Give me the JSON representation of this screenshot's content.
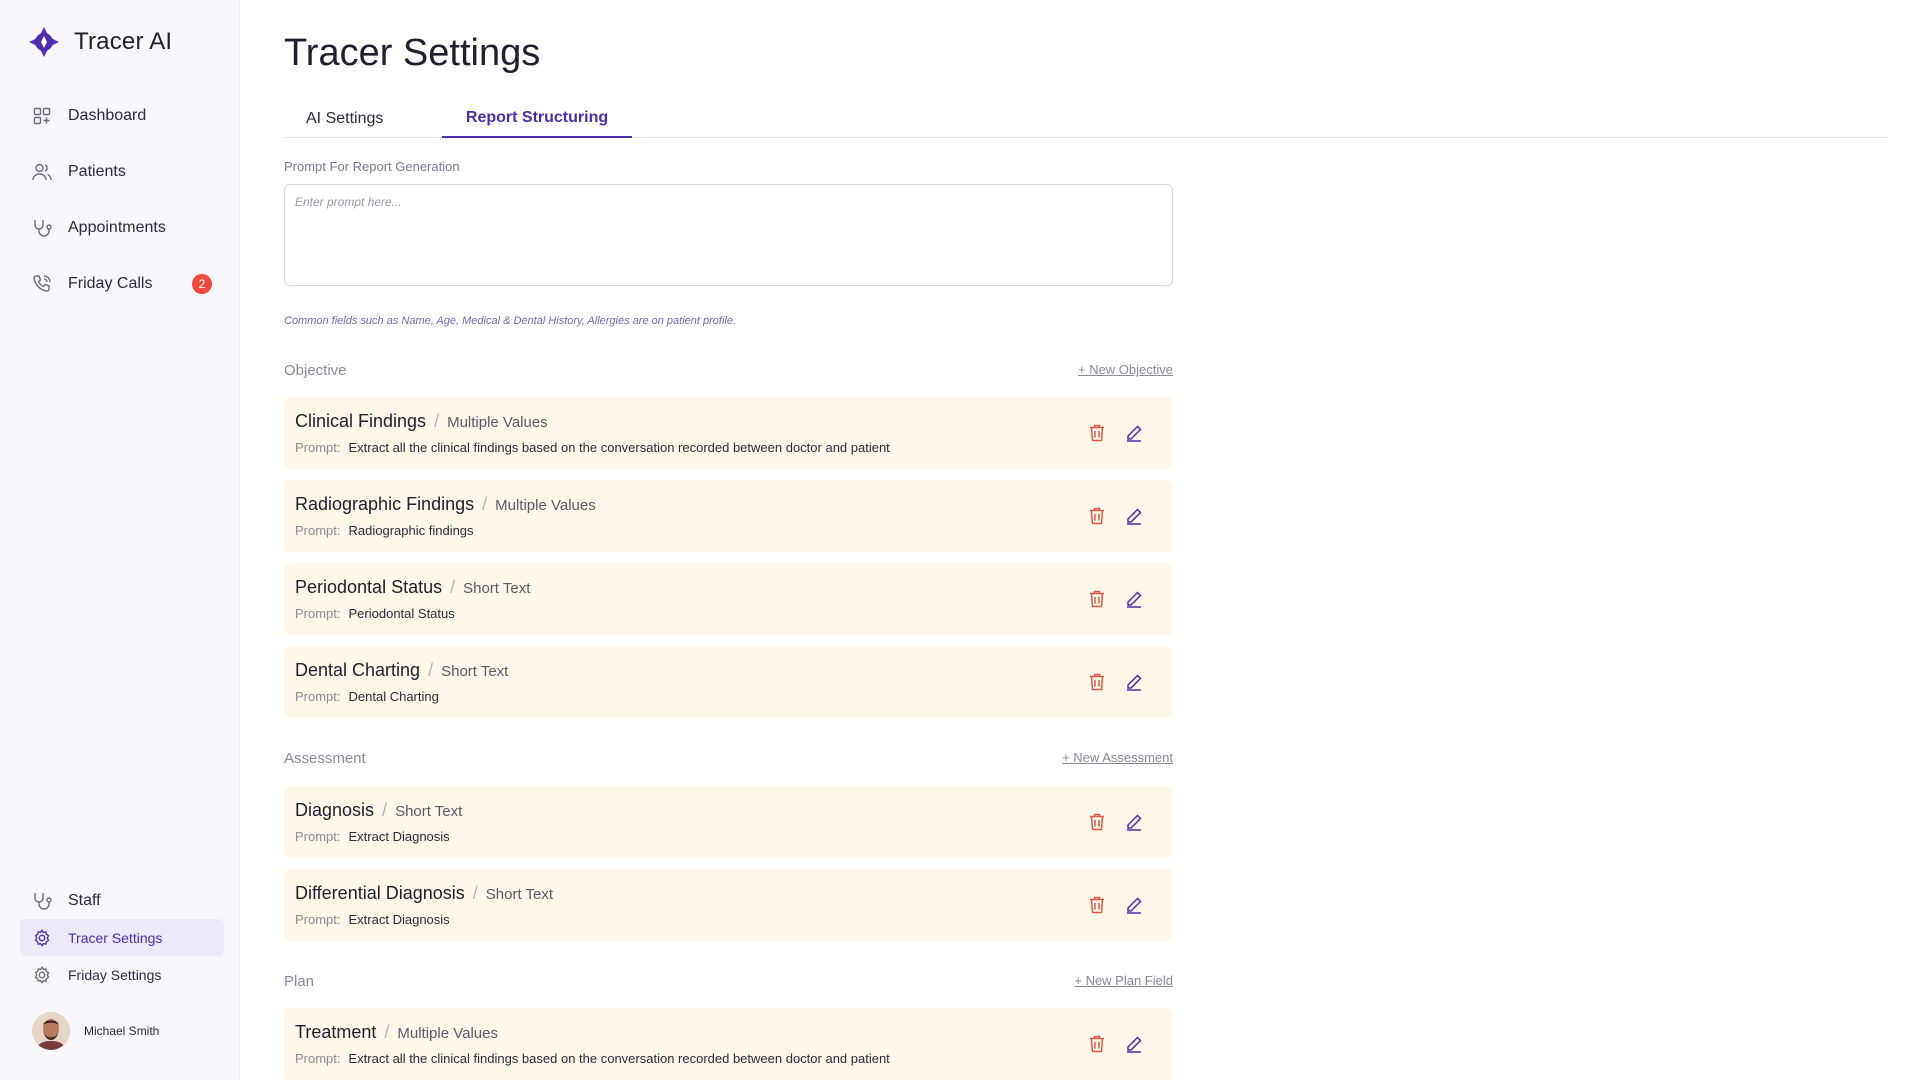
{
  "app": {
    "name": "Tracer AI"
  },
  "sidebar": {
    "items": [
      {
        "label": "Dashboard",
        "icon": "dashboard-icon"
      },
      {
        "label": "Patients",
        "icon": "users-icon"
      },
      {
        "label": "Appointments",
        "icon": "stethoscope-icon"
      },
      {
        "label": "Friday Calls",
        "icon": "phone-icon",
        "badge": "2"
      }
    ],
    "bottom_items": [
      {
        "label": "Staff",
        "icon": "stethoscope-icon"
      },
      {
        "label": "Tracer Settings",
        "icon": "gear-icon",
        "active": true
      },
      {
        "label": "Friday Settings",
        "icon": "gear-icon"
      }
    ],
    "user": {
      "name": "Michael Smith"
    }
  },
  "page": {
    "title": "Tracer Settings",
    "tabs": [
      {
        "label": "AI Settings"
      },
      {
        "label": "Report Structuring",
        "active": true
      }
    ],
    "prompt_label": "Prompt For Report Generation",
    "prompt_placeholder": "Enter prompt here...",
    "hint": "Common fields such as Name, Age, Medical & Dental History, Allergies are on patient profile.",
    "prompt_prefix": "Prompt:"
  },
  "sections": [
    {
      "title": "Objective",
      "link": "+ New Objective",
      "items": [
        {
          "name": "Clinical Findings",
          "type": "Multiple Values",
          "prompt": "Extract all the clinical findings based on the conversation recorded between doctor and patient"
        },
        {
          "name": "Radiographic Findings",
          "type": "Multiple Values",
          "prompt": "Radiographic findings"
        },
        {
          "name": "Periodontal Status",
          "type": "Short Text",
          "prompt": "Periodontal Status"
        },
        {
          "name": "Dental Charting",
          "type": "Short Text",
          "prompt": "Dental Charting"
        }
      ]
    },
    {
      "title": "Assessment",
      "link": "+ New Assessment",
      "items": [
        {
          "name": "Diagnosis",
          "type": "Short Text",
          "prompt": "Extract Diagnosis"
        },
        {
          "name": "Differential Diagnosis",
          "type": "Short Text",
          "prompt": "Extract Diagnosis"
        }
      ]
    },
    {
      "title": "Plan",
      "link": "+ New Plan Field",
      "items": [
        {
          "name": "Treatment",
          "type": "Multiple Values",
          "prompt": "Extract all the clinical findings based on the conversation recorded between doctor and patient"
        }
      ]
    }
  ],
  "colors": {
    "accent": "#4b2ea8",
    "card_bg": "#fdf8e9",
    "delete": "#e0574a",
    "edit": "#4b2ea8",
    "badge": "#ef4a3c"
  }
}
